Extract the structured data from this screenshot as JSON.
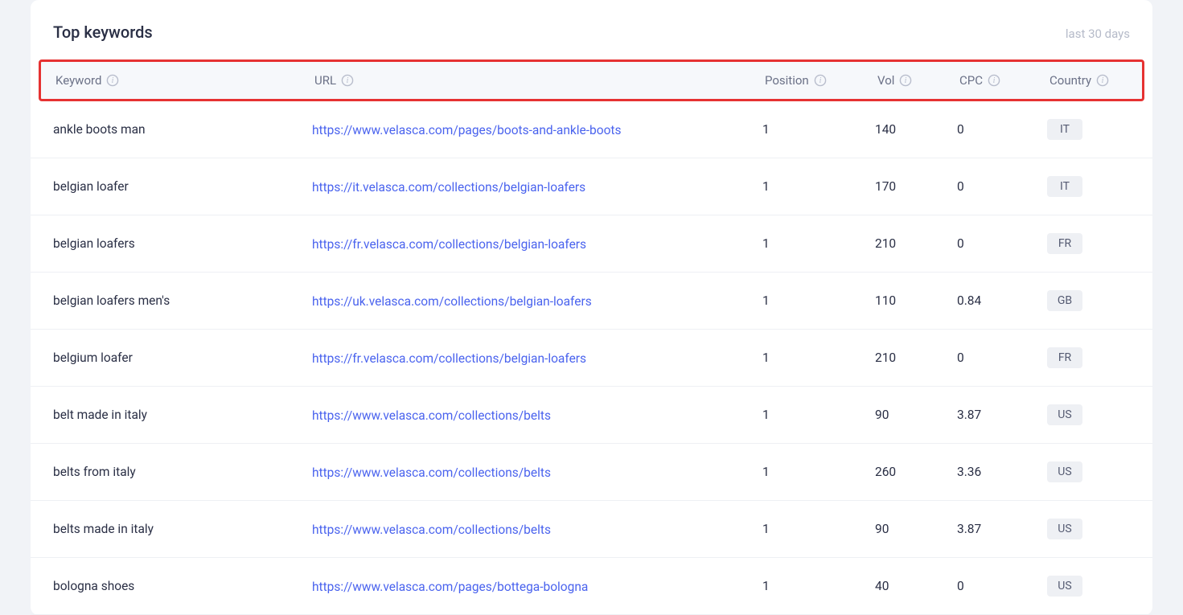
{
  "title": "Top keywords",
  "subtitle": "last 30 days",
  "columns": {
    "keyword": "Keyword",
    "url": "URL",
    "position": "Position",
    "vol": "Vol",
    "cpc": "CPC",
    "country": "Country"
  },
  "rows": [
    {
      "keyword": "ankle boots man",
      "url": "https://www.velasca.com/pages/boots-and-ankle-boots",
      "position": "1",
      "vol": "140",
      "cpc": "0",
      "country": "IT"
    },
    {
      "keyword": "belgian loafer",
      "url": "https://it.velasca.com/collections/belgian-loafers",
      "position": "1",
      "vol": "170",
      "cpc": "0",
      "country": "IT"
    },
    {
      "keyword": "belgian loafers",
      "url": "https://fr.velasca.com/collections/belgian-loafers",
      "position": "1",
      "vol": "210",
      "cpc": "0",
      "country": "FR"
    },
    {
      "keyword": "belgian loafers men's",
      "url": "https://uk.velasca.com/collections/belgian-loafers",
      "position": "1",
      "vol": "110",
      "cpc": "0.84",
      "country": "GB"
    },
    {
      "keyword": "belgium loafer",
      "url": "https://fr.velasca.com/collections/belgian-loafers",
      "position": "1",
      "vol": "210",
      "cpc": "0",
      "country": "FR"
    },
    {
      "keyword": "belt made in italy",
      "url": "https://www.velasca.com/collections/belts",
      "position": "1",
      "vol": "90",
      "cpc": "3.87",
      "country": "US"
    },
    {
      "keyword": "belts from italy",
      "url": "https://www.velasca.com/collections/belts",
      "position": "1",
      "vol": "260",
      "cpc": "3.36",
      "country": "US"
    },
    {
      "keyword": "belts made in italy",
      "url": "https://www.velasca.com/collections/belts",
      "position": "1",
      "vol": "90",
      "cpc": "3.87",
      "country": "US"
    },
    {
      "keyword": "bologna shoes",
      "url": "https://www.velasca.com/pages/bottega-bologna",
      "position": "1",
      "vol": "40",
      "cpc": "0",
      "country": "US"
    }
  ]
}
